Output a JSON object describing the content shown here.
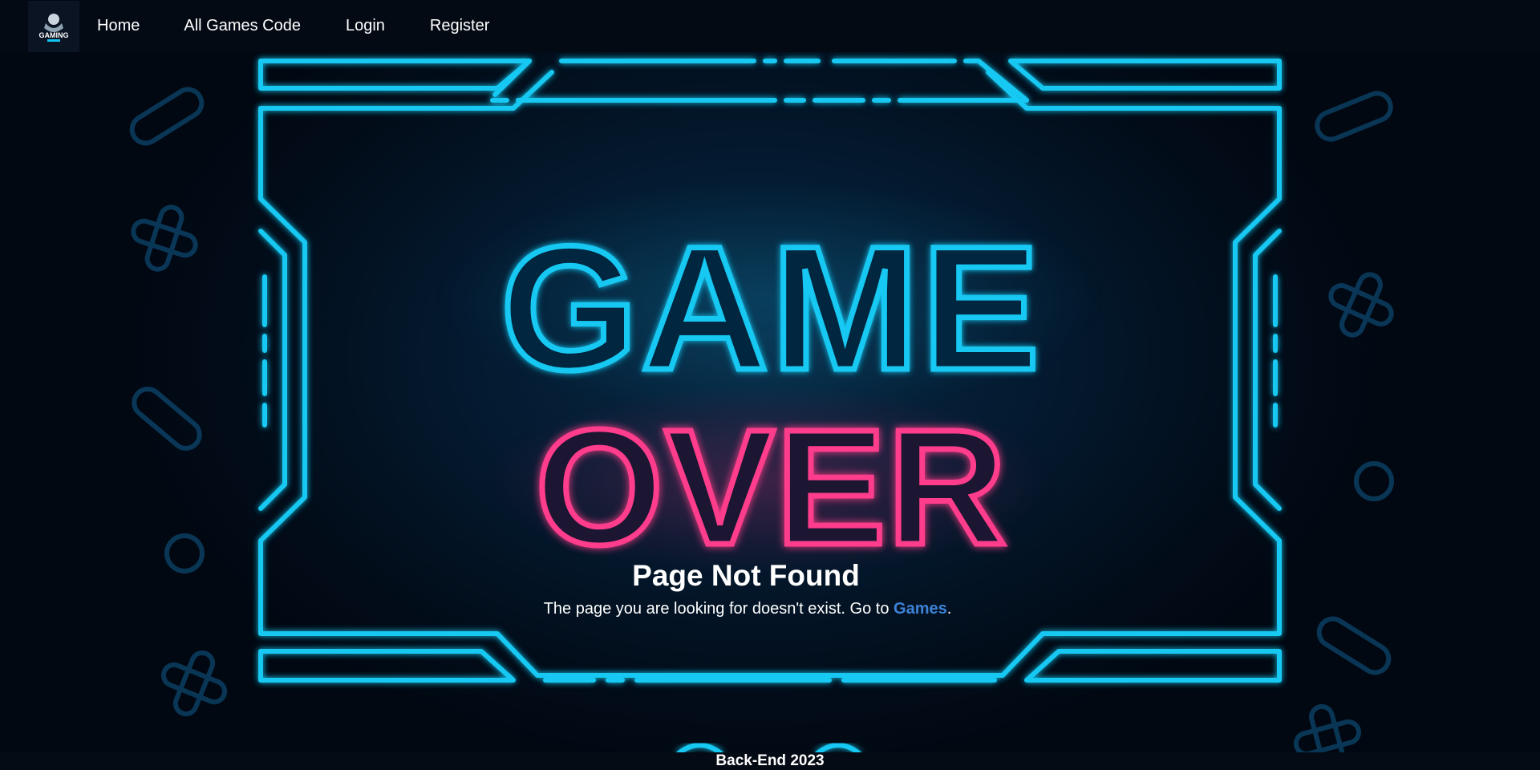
{
  "nav": {
    "logo_text": "GAMING",
    "links": [
      {
        "label": "Home"
      },
      {
        "label": "All Games Code"
      },
      {
        "label": "Login"
      },
      {
        "label": "Register"
      }
    ]
  },
  "hero": {
    "line1": "GAME",
    "line2": "OVER"
  },
  "message": {
    "title": "Page Not Found",
    "text_before": "The page you are looking for doesn't exist. Go to ",
    "link_label": "Games",
    "text_after": "."
  },
  "footer": {
    "text": "Back-End 2023"
  },
  "colors": {
    "neon_blue": "#12c8f2",
    "neon_pink": "#ff3d8c",
    "link": "#3d82d6"
  }
}
